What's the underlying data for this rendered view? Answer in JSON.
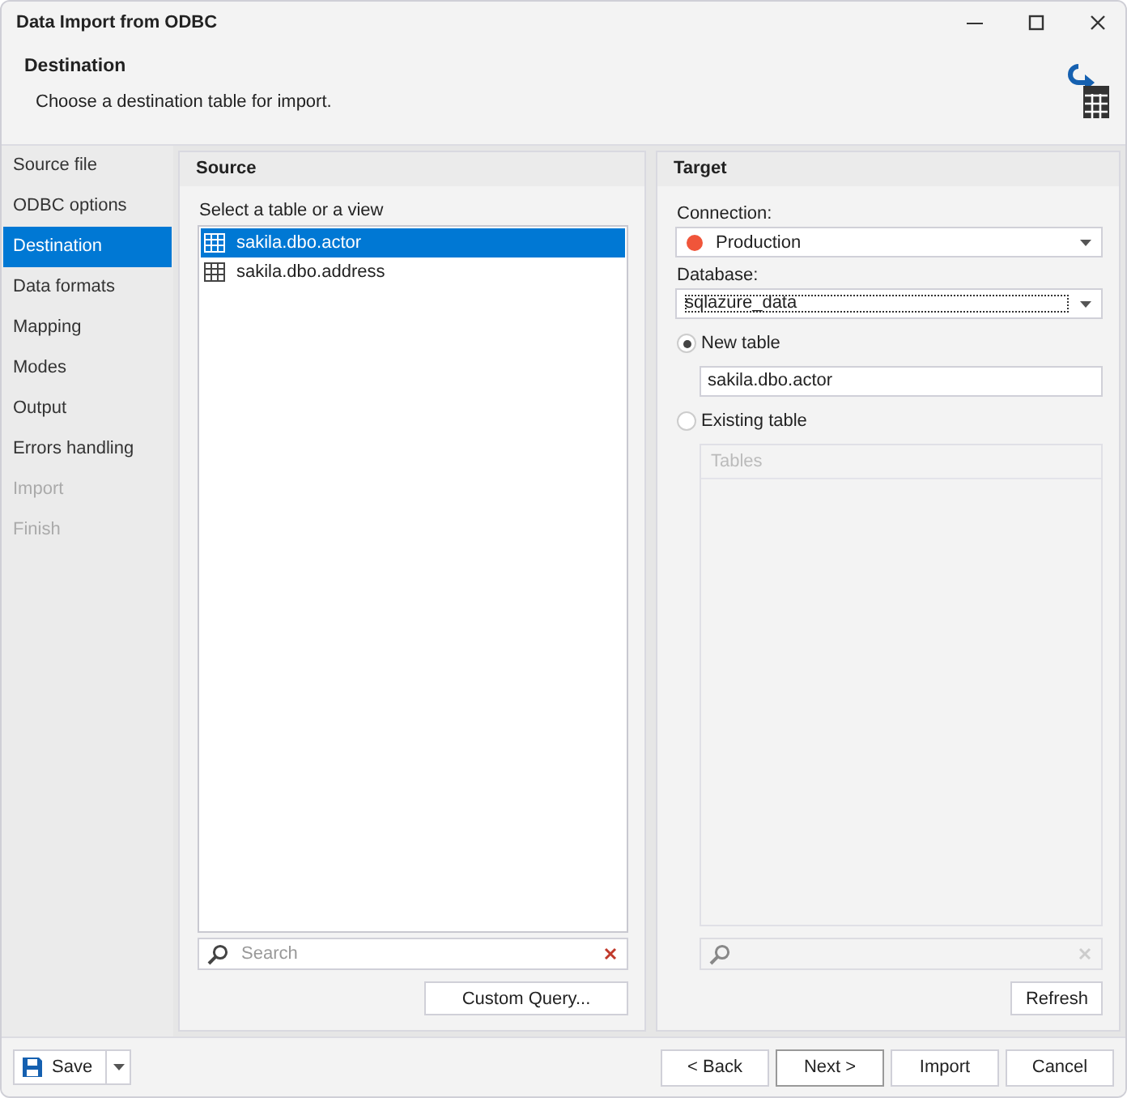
{
  "window": {
    "title": "Data Import from ODBC"
  },
  "header": {
    "title": "Destination",
    "subtitle": "Choose a destination table for import."
  },
  "sidebar": {
    "items": [
      {
        "label": "Source file",
        "selected": false,
        "disabled": false
      },
      {
        "label": "ODBC options",
        "selected": false,
        "disabled": false
      },
      {
        "label": "Destination",
        "selected": true,
        "disabled": false
      },
      {
        "label": "Data formats",
        "selected": false,
        "disabled": false
      },
      {
        "label": "Mapping",
        "selected": false,
        "disabled": false
      },
      {
        "label": "Modes",
        "selected": false,
        "disabled": false
      },
      {
        "label": "Output",
        "selected": false,
        "disabled": false
      },
      {
        "label": "Errors handling",
        "selected": false,
        "disabled": false
      },
      {
        "label": "Import",
        "selected": false,
        "disabled": true
      },
      {
        "label": "Finish",
        "selected": false,
        "disabled": true
      }
    ]
  },
  "source": {
    "title": "Source",
    "list_label": "Select a table or a view",
    "tables": [
      {
        "name": "sakila.dbo.actor",
        "selected": true
      },
      {
        "name": "sakila.dbo.address",
        "selected": false
      }
    ],
    "search": {
      "placeholder": "Search"
    },
    "button": "Custom Query..."
  },
  "target": {
    "title": "Target",
    "connection": {
      "label": "Connection:",
      "value": "Production",
      "color": "#f0553a"
    },
    "database": {
      "label": "Database:",
      "value": "sqlazure_data"
    },
    "options": [
      {
        "label": "New table",
        "selected": true
      },
      {
        "label": "Existing table",
        "selected": false
      }
    ],
    "new_table_name": "sakila.dbo.actor",
    "tables_grid": {
      "column": "Tables",
      "disabled": true
    },
    "button": "Refresh"
  },
  "footer": {
    "save": "Save",
    "buttons": [
      "< Back",
      "Next >",
      "Import",
      "Cancel"
    ]
  }
}
